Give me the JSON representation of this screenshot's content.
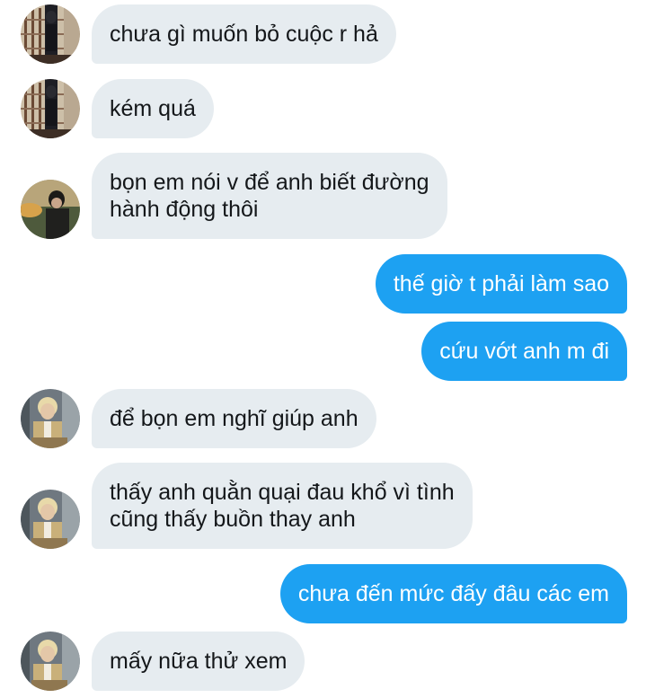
{
  "messages": [
    {
      "direction": "in",
      "sender": "window-avatar",
      "lines": [
        "chưa gì muốn bỏ cuộc r hả"
      ]
    },
    {
      "direction": "in",
      "sender": "window-avatar",
      "lines": [
        "kém quá"
      ]
    },
    {
      "direction": "in",
      "sender": "sunset-avatar",
      "lines": [
        "bọn em nói v để anh biết đường",
        "hành động thôi"
      ]
    },
    {
      "direction": "out",
      "lines": [
        "thế giờ t phải làm sao"
      ]
    },
    {
      "direction": "out",
      "lines": [
        "cứu vớt anh m đi"
      ]
    },
    {
      "direction": "in",
      "sender": "blond-avatar",
      "lines": [
        "để bọn em nghĩ giúp anh"
      ]
    },
    {
      "direction": "in",
      "sender": "blond-avatar",
      "lines": [
        "thấy anh quằn quại đau khổ vì tình",
        "cũng thấy buồn thay anh"
      ]
    },
    {
      "direction": "out",
      "lines": [
        "chưa đến mức đấy đâu các em"
      ]
    },
    {
      "direction": "in",
      "sender": "blond-avatar",
      "lines": [
        "mấy nữa thử xem"
      ]
    }
  ],
  "colors": {
    "incoming_bubble": "#e6ecf0",
    "outgoing_bubble": "#1da1f2",
    "incoming_text": "#14171a",
    "outgoing_text": "#ffffff"
  }
}
